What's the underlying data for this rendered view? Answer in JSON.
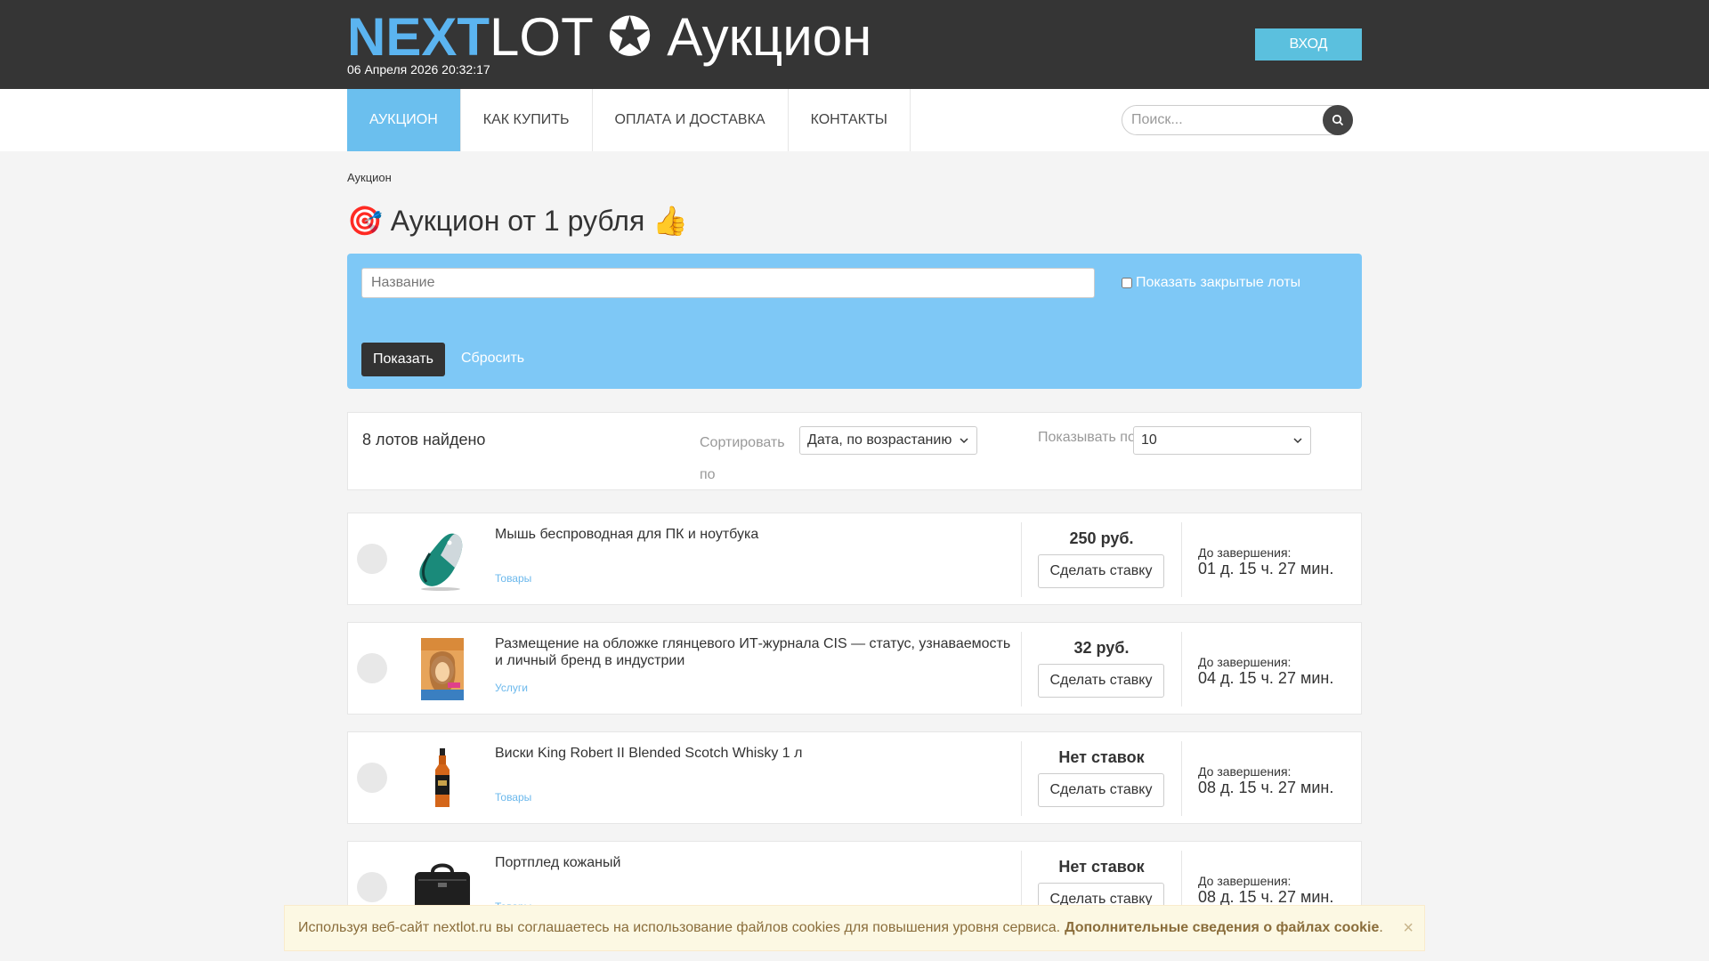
{
  "header": {
    "logo_accent": "NEXT",
    "logo_rest": "LOT",
    "logo_star": "✪",
    "logo_suffix": "Аукцион",
    "datetime": "06 Апреля 2026 20:32:17",
    "login_label": "ВХОД"
  },
  "nav": {
    "items": [
      {
        "label": "АУКЦИОН",
        "active": true
      },
      {
        "label": "КАК КУПИТЬ"
      },
      {
        "label": "ОПЛАТА И ДОСТАВКА"
      },
      {
        "label": "КОНТАКТЫ"
      }
    ],
    "search_placeholder": "Поиск...",
    "search_icon": "search-icon"
  },
  "breadcrumb": "Аукцион",
  "page_title": "🎯 Аукцион от 1 рубля 👍",
  "filter": {
    "name_placeholder": "Название",
    "closed_label": "Показать закрытые лоты",
    "closed_checked": false,
    "show_label": "Показать",
    "reset_label": "Сбросить"
  },
  "listing": {
    "count_text": "8 лотов найдено",
    "sort_label": "Сортировать по",
    "sort_value": "Дата, по возрастанию",
    "perpage_label": "Показывать по",
    "perpage_value": "10"
  },
  "lots": [
    {
      "title": "Мышь беспроводная для ПК и ноутбука",
      "category": "Товары",
      "price": "250 руб.",
      "bid_label": "Сделать ставку",
      "ends_label": "До завершения:",
      "ends_value": "01 д. 15 ч. 27 мин."
    },
    {
      "title": "Размещение на обложке глянцевого ИТ-журнала CIS — статус, узнаваемость и личный бренд в индустрии",
      "category": "Услуги",
      "price": "32 руб.",
      "bid_label": "Сделать ставку",
      "ends_label": "До завершения:",
      "ends_value": "04 д. 15 ч. 27 мин."
    },
    {
      "title": "Виски King Robert II Blended Scotch Whisky 1 л",
      "category": "Товары",
      "price": "Нет ставок",
      "bid_label": "Сделать ставку",
      "ends_label": "До завершения:",
      "ends_value": "08 д. 15 ч. 27 мин."
    },
    {
      "title": "Портплед кожаный",
      "category": "Товары",
      "price": "Нет ставок",
      "bid_label": "Сделать ставку",
      "ends_label": "До завершения:",
      "ends_value": "08 д. 15 ч. 27 мин."
    }
  ],
  "cookie": {
    "text": "Используя веб-сайт nextlot.ru вы соглашаетесь на использование файлов cookies для повышения уровня сервиса.",
    "link": "Дополнительные сведения о файлах cookie",
    "dot": ".",
    "close": "×"
  },
  "colors": {
    "header_bg": "#353535",
    "accent": "#5bb4f0",
    "filter_bg": "#7ec8f6",
    "login_bg": "#5bc0de"
  }
}
